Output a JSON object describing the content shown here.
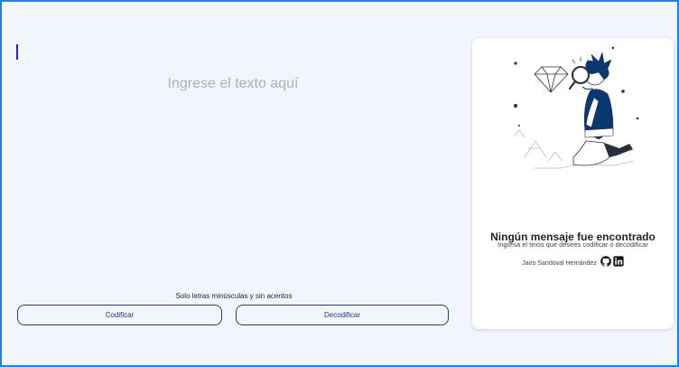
{
  "input": {
    "placeholder": "Ingrese el texto aquí",
    "hint": "Solo letras minúsculas y sin acentos"
  },
  "buttons": {
    "encode_label": "Codificar",
    "decode_label": "Decodificar"
  },
  "result_panel": {
    "title": "Ningún mensaje fue encontrado",
    "subtitle": "Ingresa el texto que desees codificar o decodificar",
    "author": "Jairo Sandoval Hernández",
    "social_icons": [
      "github-icon",
      "linkedin-icon"
    ]
  },
  "colors": {
    "page_border": "#1a82f0",
    "background": "#f2f5fc",
    "accent_dark": "#0a3871",
    "button_border": "#21406e",
    "placeholder": "#a6b0c6"
  }
}
